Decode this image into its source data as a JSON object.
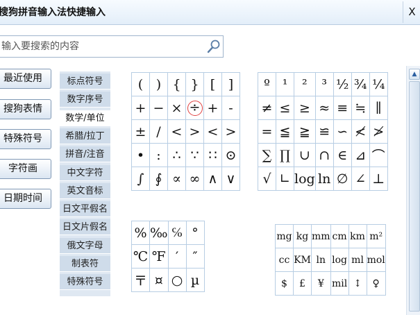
{
  "window": {
    "title": "搜狗拼音输入法快捷输入",
    "close_label": "X"
  },
  "search": {
    "placeholder": "输入要搜索的内容",
    "icon": "search-icon"
  },
  "categories": [
    "最近使用",
    "搜狗表情",
    "特殊符号",
    "字符画",
    "日期时间"
  ],
  "tabs": [
    "标点符号",
    "数字序号",
    "数学/单位",
    "希腊/拉丁",
    "拼音/注音",
    "中文字符",
    "英文音标",
    "日文平假名",
    "日文片假名",
    "俄文字母",
    "制表符",
    "特殊符号"
  ],
  "active_tab": "数学/单位",
  "grids": {
    "math_a": [
      [
        "(",
        ")",
        "{",
        "}",
        "[",
        "]"
      ],
      [
        "+",
        "−",
        "×",
        "÷",
        "+",
        "-"
      ],
      [
        "±",
        "/",
        "<",
        ">",
        "<",
        ">"
      ],
      [
        "•",
        ":",
        "∴",
        "∵",
        "∷",
        "⊙"
      ],
      [
        "∫",
        "∮",
        "∝",
        "∞",
        "∧",
        "∨"
      ]
    ],
    "math_b": [
      [
        "º",
        "¹",
        "²",
        "³",
        "½",
        "¾",
        "¼"
      ],
      [
        "≠",
        "≤",
        "≥",
        "≈",
        "≡",
        "≒",
        "∥"
      ],
      [
        "=",
        "≦",
        "≧",
        "≌",
        "∽",
        "≮",
        "≯"
      ],
      [
        "∑",
        "∏",
        "∪",
        "∩",
        "∈",
        "⊿",
        "⌒"
      ],
      [
        "√",
        "∟",
        "log",
        "ln",
        "∅",
        "∠",
        "⊥"
      ]
    ],
    "units_a": [
      [
        "%",
        "‰",
        "℅",
        "°"
      ],
      [
        "℃",
        "℉",
        "′",
        "″"
      ],
      [
        "〒",
        "¤",
        "○",
        "µ"
      ]
    ],
    "units_b": [
      [
        "mg",
        "kg",
        "mm",
        "cm",
        "km",
        "m²"
      ],
      [
        "cc",
        "KM",
        "ln",
        "log",
        "ml",
        "mol"
      ],
      [
        "$",
        "£",
        "¥",
        "mil",
        "↕",
        "♀"
      ]
    ]
  },
  "highlighted_symbol": "÷"
}
